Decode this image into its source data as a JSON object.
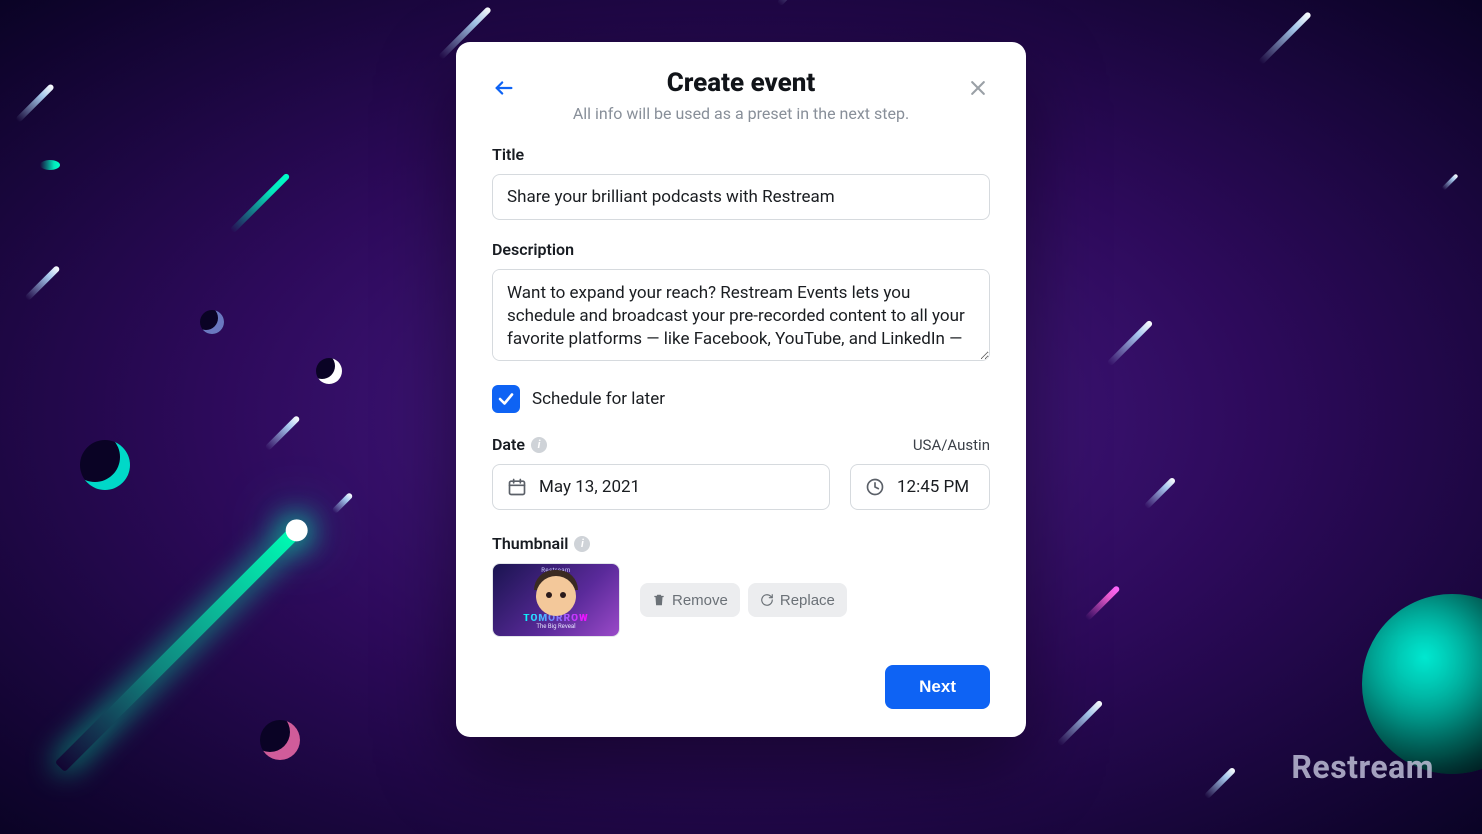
{
  "brand": "Restream",
  "modal": {
    "title": "Create event",
    "subtitle": "All info will be used as a preset in the next step.",
    "labels": {
      "title": "Title",
      "description": "Description",
      "schedule": "Schedule for later",
      "date": "Date",
      "thumbnail": "Thumbnail"
    },
    "fields": {
      "title": "Share your brilliant podcasts with Restream",
      "description": "Want to expand your reach? Restream Events lets you schedule and broadcast your pre-recorded content to all your favorite platforms — like Facebook, YouTube, and LinkedIn —",
      "schedule_checked": true,
      "date": "May 13, 2021",
      "time": "12:45 PM",
      "timezone": "USA/Austin"
    },
    "thumbnail": {
      "brand": "Restream",
      "headline": "TOMORROW",
      "sub": "The Big Reveal",
      "remove_label": "Remove",
      "replace_label": "Replace"
    },
    "next_label": "Next"
  }
}
